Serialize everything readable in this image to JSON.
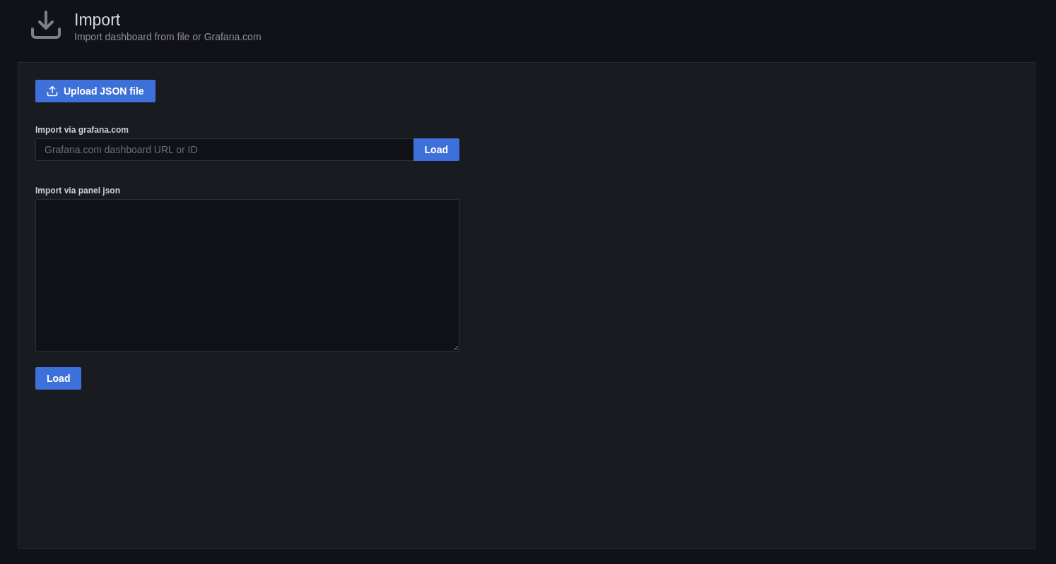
{
  "header": {
    "title": "Import",
    "subtitle": "Import dashboard from file or Grafana.com"
  },
  "upload_button": {
    "label": "Upload JSON file"
  },
  "grafana_import": {
    "label": "Import via grafana.com",
    "placeholder": "Grafana.com dashboard URL or ID",
    "button": "Load"
  },
  "panel_json": {
    "label": "Import via panel json",
    "button": "Load"
  }
}
